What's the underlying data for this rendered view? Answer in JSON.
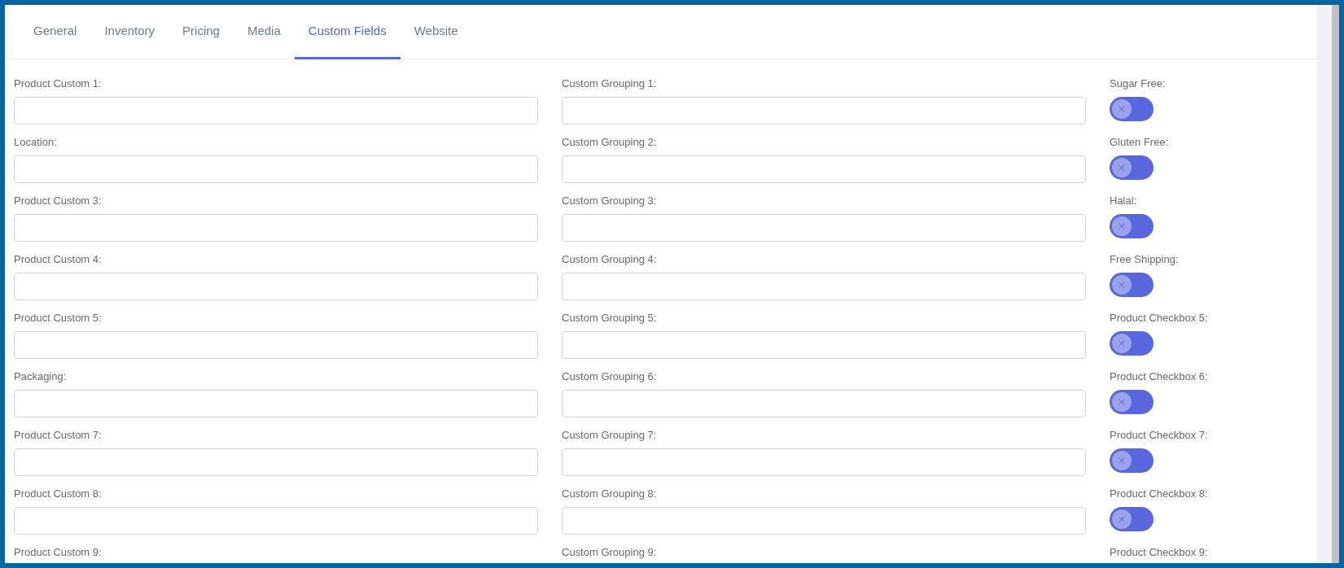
{
  "tabs": [
    {
      "label": "General",
      "selected": false
    },
    {
      "label": "Inventory",
      "selected": false
    },
    {
      "label": "Pricing",
      "selected": false
    },
    {
      "label": "Media",
      "selected": false
    },
    {
      "label": "Custom Fields",
      "selected": true
    },
    {
      "label": "Website",
      "selected": false
    }
  ],
  "left_fields": [
    {
      "label": "Product Custom 1:"
    },
    {
      "label": "Location:"
    },
    {
      "label": "Product Custom 3:"
    },
    {
      "label": "Product Custom 4:"
    },
    {
      "label": "Product Custom 5:"
    },
    {
      "label": "Packaging:"
    },
    {
      "label": "Product Custom 7:"
    },
    {
      "label": "Product Custom 8:"
    },
    {
      "label": "Product Custom 9:"
    }
  ],
  "middle_fields": [
    {
      "label": "Custom Grouping 1:"
    },
    {
      "label": "Custom Grouping 2:"
    },
    {
      "label": "Custom Grouping 3:"
    },
    {
      "label": "Custom Grouping 4:"
    },
    {
      "label": "Custom Grouping 5:"
    },
    {
      "label": "Custom Grouping 6:"
    },
    {
      "label": "Custom Grouping 7:"
    },
    {
      "label": "Custom Grouping 8:"
    },
    {
      "label": "Custom Grouping 9:"
    }
  ],
  "toggles": [
    {
      "label": "Sugar Free:",
      "on": false
    },
    {
      "label": "Gluten Free:",
      "on": false
    },
    {
      "label": "Halal:",
      "on": false
    },
    {
      "label": "Free Shipping:",
      "on": false
    },
    {
      "label": "Product Checkbox 5:",
      "on": false
    },
    {
      "label": "Product Checkbox 6:",
      "on": false
    },
    {
      "label": "Product Checkbox 7:",
      "on": false
    },
    {
      "label": "Product Checkbox 8:",
      "on": false
    },
    {
      "label": "Product Checkbox 9:"
    }
  ]
}
